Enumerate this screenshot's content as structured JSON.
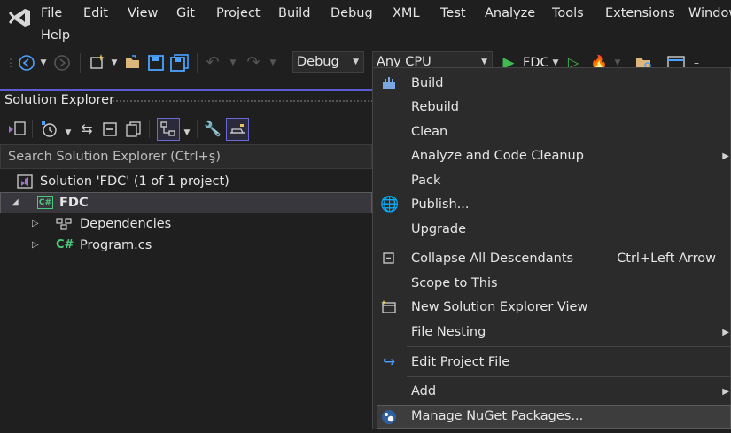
{
  "menubar": {
    "items": [
      "File",
      "Edit",
      "View",
      "Git",
      "Project",
      "Build",
      "Debug",
      "XML",
      "Test",
      "Analyze",
      "Tools",
      "Extensions",
      "Window",
      "Help"
    ]
  },
  "toolbar": {
    "config": "Debug",
    "platform": "Any CPU",
    "run_target": "FDC"
  },
  "solution_explorer": {
    "title": "Solution Explorer",
    "search_placeholder": "Search Solution Explorer (Ctrl+ş)",
    "solution": "Solution 'FDC' (1 of 1 project)",
    "project": "FDC",
    "dependencies": "Dependencies",
    "program": "Program.cs",
    "cs_badge": "C#",
    "cs_icon": "C#"
  },
  "context_menu": {
    "build": "Build",
    "rebuild": "Rebuild",
    "clean": "Clean",
    "analyze": "Analyze and Code Cleanup",
    "pack": "Pack",
    "publish": "Publish...",
    "upgrade": "Upgrade",
    "collapse": "Collapse All Descendants",
    "collapse_shortcut": "Ctrl+Left Arrow",
    "scope": "Scope to This",
    "new_view": "New Solution Explorer View",
    "file_nesting": "File Nesting",
    "edit_project": "Edit Project File",
    "add": "Add",
    "nuget": "Manage NuGet Packages..."
  },
  "colors": {
    "accent": "#5b5bd6",
    "background": "#1f1f1f",
    "menu_bg": "#2b2b2b",
    "run_green": "#3fb950",
    "csharp_green": "#4ec97b"
  }
}
